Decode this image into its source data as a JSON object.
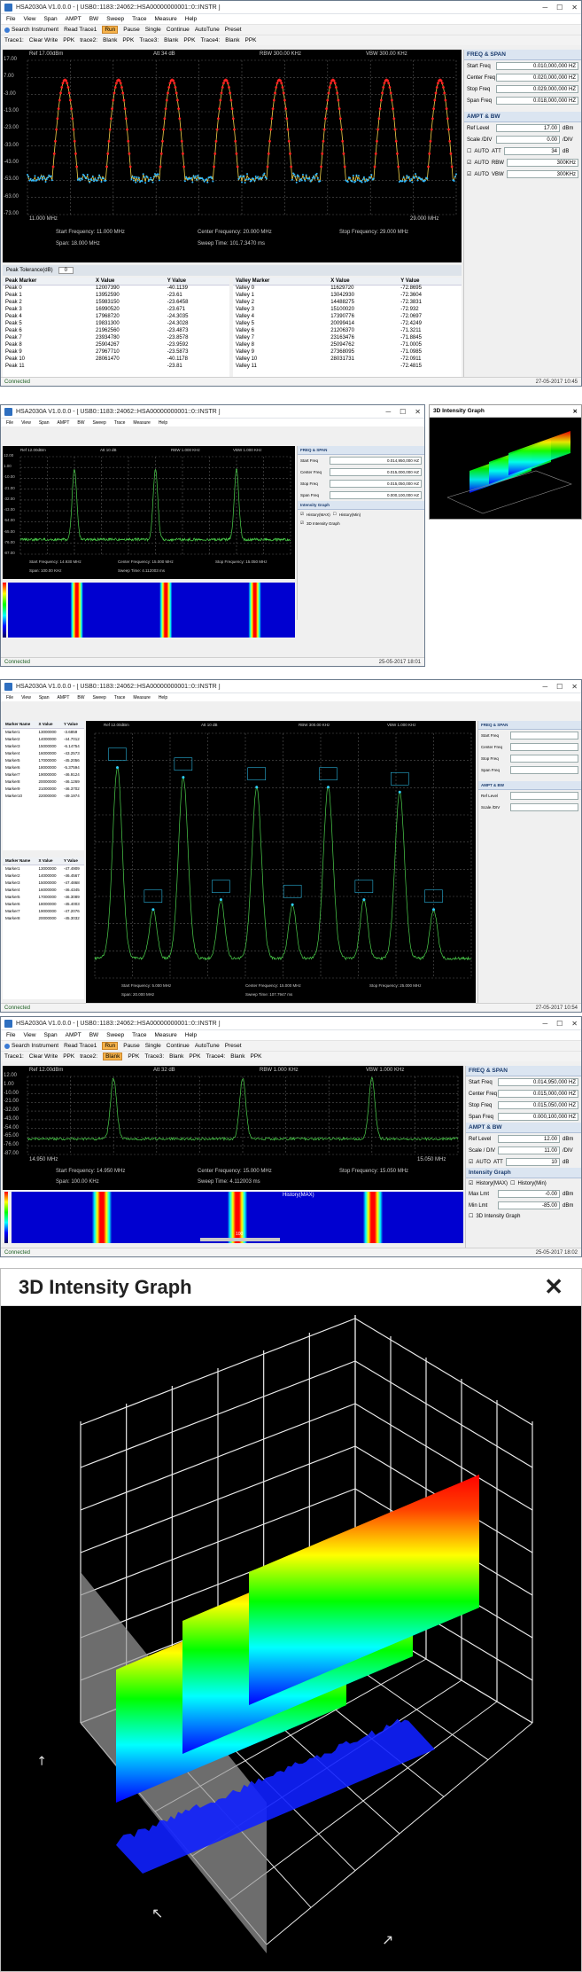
{
  "win1": {
    "title": "HSA2030A V1.0.0.0  -  [ USB0::1183::24062::HSA00000000001::0::INSTR ]",
    "date": "27-05-2017  10:45",
    "plot_top": [
      "Ref 17.00dBm",
      "Att 34 dB",
      "RBW 300.00 KHz",
      "VBW 300.00 KHz"
    ],
    "yticks": [
      "17.00",
      "7.00",
      "-3.00",
      "-13.00",
      "-23.00",
      "-33.00",
      "-43.00",
      "-53.00",
      "-63.00",
      "-73.00"
    ],
    "start_freq_lbl": "11.000 MHz",
    "stop_freq_lbl": "29.000 MHz",
    "bottom": [
      "Start Frequency: 11.000 MHz",
      "Center Frequency: 20.000 MHz",
      "Stop Frequency: 29.000 MHz",
      "Span: 18.000 MHz",
      "Sweep Time: 101.7.3470 ms"
    ],
    "side": {
      "hdr1": "FREQ & SPAN",
      "fields": [
        {
          "label": "Start Freq",
          "value": "0.010,000,000 HZ",
          "unit": ""
        },
        {
          "label": "Center Freq",
          "value": "0.020,000,000 HZ",
          "unit": ""
        },
        {
          "label": "Stop Freq",
          "value": "0.029,000,000 HZ",
          "unit": ""
        },
        {
          "label": "Span Freq",
          "value": "0.018,000,000 HZ",
          "unit": ""
        }
      ],
      "hdr2": "AMPT & BW",
      "ampt": [
        {
          "label": "Ref Level",
          "value": "17.00",
          "unit": "dBm"
        },
        {
          "label": "Scale /DIV",
          "value": "0.00",
          "unit": "/DIV"
        }
      ],
      "opts": [
        {
          "a": "AUTO",
          "b": "ATT",
          "v": "34",
          "u": "dB"
        },
        {
          "a": "AUTO",
          "b": "RBW",
          "v": "300KHz",
          "u": ""
        },
        {
          "a": "AUTO",
          "b": "VBW",
          "v": "300KHz",
          "u": ""
        }
      ]
    },
    "tab_label": "Peak Tolerance(dB)",
    "tol": "0",
    "peak_hdr": [
      "Peak Marker",
      "X Value",
      "Y Value"
    ],
    "valley_hdr": [
      "Valley Marker",
      "X Value",
      "Y Value"
    ],
    "peaks": [
      [
        "Peak 0",
        "12007390",
        "-40.1139"
      ],
      [
        "Peak 1",
        "13952590",
        "-23.61"
      ],
      [
        "Peak 2",
        "15983150",
        "-23.6458"
      ],
      [
        "Peak 3",
        "16990520",
        "-23.671"
      ],
      [
        "Peak 4",
        "17968720",
        "-24.3035"
      ],
      [
        "Peak 5",
        "19831300",
        "-24.3028"
      ],
      [
        "Peak 6",
        "21962560",
        "-23.4873"
      ],
      [
        "Peak 7",
        "23934780",
        "-23.8578"
      ],
      [
        "Peak 8",
        "25904267",
        "-23.9592"
      ],
      [
        "Peak 9",
        "27967710",
        "-23.5873"
      ],
      [
        "Peak 10",
        "28061470",
        "-40.1178"
      ],
      [
        "Peak 11",
        "",
        "-23.81"
      ]
    ],
    "valleys": [
      [
        "Valley 0",
        "11629720",
        "-72.8695"
      ],
      [
        "Valley 1",
        "13042930",
        "-72.3604"
      ],
      [
        "Valley 2",
        "14488275",
        "-72.3831"
      ],
      [
        "Valley 3",
        "15100020",
        "-72.932"
      ],
      [
        "Valley 4",
        "17390776",
        "-72.0697"
      ],
      [
        "Valley 5",
        "20099414",
        "-72.4249"
      ],
      [
        "Valley 6",
        "21206370",
        "-71.3211"
      ],
      [
        "Valley 7",
        "23163476",
        "-71.8845"
      ],
      [
        "Valley 8",
        "25094762",
        "-71.0005"
      ],
      [
        "Valley 9",
        "27368095",
        "-71.0985"
      ],
      [
        "Valley 10",
        "28031731",
        "-72.0911"
      ],
      [
        "Valley 11",
        "",
        "-72.4815"
      ]
    ],
    "status": "Connected"
  },
  "win2": {
    "title": "HSA2030A V1.0.0.0  -  [ USB0::1183::24062::HSA00000000001::0::INSTR ]",
    "date": "25-05-2017  18:01",
    "plot_top": [
      "Ref 12.00dBm",
      "Att 10 dB",
      "RBW 1.000 KHz",
      "VBW 1.000 KHz"
    ],
    "yticks": [
      "12.00",
      "1.00",
      "-10.00",
      "-21.00",
      "-32.00",
      "-43.00",
      "-54.00",
      "-65.00",
      "-76.00",
      "-87.00"
    ],
    "bottom": [
      "Start Frequency: 14.930 MHz",
      "Center Frequency: 15.000 MHz",
      "Stop Frequency: 15.050 MHz",
      "Span: 100.00 KHz",
      "Sweep Time: 4.112003 ms"
    ],
    "s3d_title": "3D Intensity Graph",
    "status": "Connected"
  },
  "win3": {
    "title": "HSA2030A V1.0.0.0  -  [ USB0::1183::24062::HSA00000000001::0::INSTR ]",
    "date": "27-05-2017  10:54",
    "marker_hdr": [
      "Marker Name",
      "X Value",
      "Y Value"
    ],
    "markers_a": [
      [
        "Marker1",
        "13000000",
        "-3.6859"
      ],
      [
        "Marker2",
        "14000000",
        "-44.7012"
      ],
      [
        "Marker3",
        "15000000",
        "-6.14754"
      ],
      [
        "Marker4",
        "16000000",
        "-43.2573"
      ],
      [
        "Marker5",
        "17000000",
        "-45.2056"
      ],
      [
        "Marker6",
        "18000000",
        "-5.37594"
      ],
      [
        "Marker7",
        "19000000",
        "-46.9124"
      ],
      [
        "Marker8",
        "20000000",
        "-46.1269"
      ],
      [
        "Marker9",
        "21000000",
        "-46.3702"
      ],
      [
        "Marker10",
        "22000000",
        "-49.1974"
      ]
    ],
    "markers_b": [
      [
        "Marker1",
        "13000000",
        "-47.4909"
      ],
      [
        "Marker2",
        "14000000",
        "-46.4567"
      ],
      [
        "Marker3",
        "15000000",
        "-47.4868"
      ],
      [
        "Marker4",
        "16000000",
        "-46.4345"
      ],
      [
        "Marker5",
        "17000000",
        "-46.3089"
      ],
      [
        "Marker6",
        "18000000",
        "-45.4003"
      ],
      [
        "Marker7",
        "19000000",
        "-47.2076"
      ],
      [
        "Marker8",
        "20000000",
        "-45.3032"
      ]
    ],
    "plot_top": [
      "Ref 12.00dBm",
      "Att 10 dB",
      "RBW 300.00 KHz",
      "VBW 1.000 KHz"
    ],
    "bottom": [
      "Start Frequency: 5.000 MHz",
      "Center Frequency: 15.000 MHz",
      "Stop Frequency: 25.000 MHz",
      "Span: 20.000 MHz",
      "Sweep Time: 107.7947 ms"
    ],
    "status": "Connected"
  },
  "win4": {
    "title": "HSA2030A V1.0.0.0  -  [ USB0::1183::24062::HSA00000000001::0::INSTR ]",
    "date": "25-05-2017  18:02",
    "menu": [
      "File",
      "View",
      "Span",
      "AMPT",
      "BW",
      "Sweep",
      "Trace",
      "Measure",
      "Help"
    ],
    "toolbar1": [
      "Search Instrument",
      "Read Trace1",
      "Run",
      "Pause",
      "Single",
      "Continue",
      "AutoTune",
      "Preset"
    ],
    "toolbar2": [
      "Trace1:",
      "Clear Write",
      "PPK",
      "trace2:",
      "Blank",
      "PPK",
      "Trace3:",
      "Blank",
      "PPK",
      "Trace4:",
      "Blank",
      "PPK"
    ],
    "plot_top": [
      "Ref 12.00dBm",
      "Att 32 dB",
      "RBW 1.000 KHz",
      "VBW 1.000 KHz"
    ],
    "yticks": [
      "12.00",
      "1.00",
      "-10.00",
      "-21.00",
      "-32.00",
      "-43.00",
      "-54.00",
      "-65.00",
      "-76.00",
      "-87.00"
    ],
    "start_freq_lbl": "14.950 MHz",
    "stop_freq_lbl": "15.050 MHz",
    "bottom": [
      "Start Frequency: 14.950 MHz",
      "Center Frequency: 15.000 MHz",
      "Stop Frequency: 15.050 MHz",
      "Span: 100.00 KHz",
      "Sweep Time: 4.112003 ms"
    ],
    "side": {
      "hdr1": "FREQ & SPAN",
      "fields": [
        {
          "label": "Start Freq",
          "value": "0.014,950,000 HZ"
        },
        {
          "label": "Center Freq",
          "value": "0.015,000,000 HZ"
        },
        {
          "label": "Stop Freq",
          "value": "0.015,050,000 HZ"
        },
        {
          "label": "Span Freq",
          "value": "0.000,100,000 HZ"
        }
      ],
      "hdr2": "AMPT & BW",
      "ampt": [
        {
          "label": "Ref Level",
          "value": "12.00",
          "unit": "dBm"
        },
        {
          "label": "Scale / DIV",
          "value": "11.00",
          "unit": "/DIV"
        }
      ],
      "att": {
        "a": "AUTO",
        "b": "ATT",
        "v": "10",
        "u": "dB"
      },
      "hdr3": "Intensity Graph",
      "ig": [
        {
          "label": "Max Lmt",
          "value": "-0.00",
          "unit": "dBm"
        },
        {
          "label": "Min Lmt",
          "value": "-85.00",
          "unit": "dBm"
        }
      ],
      "hist_a": "History(MAX)",
      "hist_b": "History(Min)",
      "g3d": "3D Intensity Graph"
    },
    "wf_label": "History(MAX)",
    "scroll": [
      "0",
      "100",
      "100"
    ],
    "status": "Connected"
  },
  "big3d": {
    "title": "3D Intensity Graph"
  }
}
